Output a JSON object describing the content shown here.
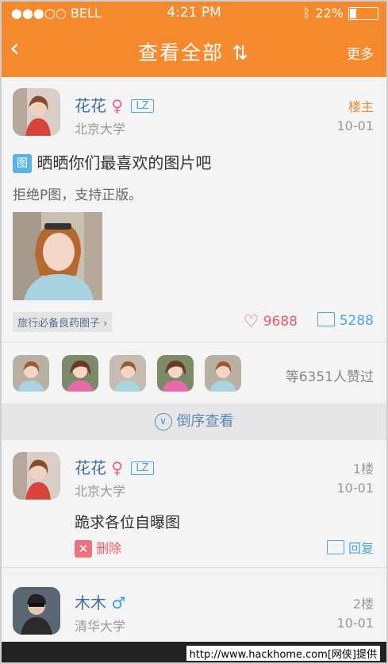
{
  "status": {
    "carrier": "●●●○○ BELL",
    "time": "4:21 PM",
    "battery": "22%",
    "battery_level": 0.22
  },
  "nav": {
    "back": "‹",
    "title": "查看全部 ⇅",
    "more": "更多"
  },
  "post": {
    "author": "花花",
    "gender": "♀",
    "badge": "LZ",
    "role": "楼主",
    "school": "北京大学",
    "date": "10-01",
    "tag_icon": "图",
    "title": "晒晒你们最喜欢的图片吧",
    "body": "拒绝P图，支持正版。",
    "circle_link": "旅行必备良药圈子 ›",
    "likes": "9688",
    "comments": "5288",
    "liked_by_text": "等6351人赞过"
  },
  "toggle": {
    "label": "倒序查看"
  },
  "replies": [
    {
      "author": "花花",
      "gender": "♀",
      "badge": "LZ",
      "floor": "1楼",
      "school": "北京大学",
      "date": "10-01",
      "text": "跪求各位自曝图",
      "delete_label": "删除",
      "reply_label": "回复"
    },
    {
      "author": "木木",
      "gender": "♂",
      "badge": "",
      "floor": "2楼",
      "school": "清华大学",
      "date": "10-01"
    }
  ],
  "watermark": "http://www.hackhome.com[网侠]提供",
  "colors": {
    "accent": "#f5892e",
    "link": "#5b87b8",
    "like": "#e85d6a",
    "comment": "#4da6e0"
  }
}
